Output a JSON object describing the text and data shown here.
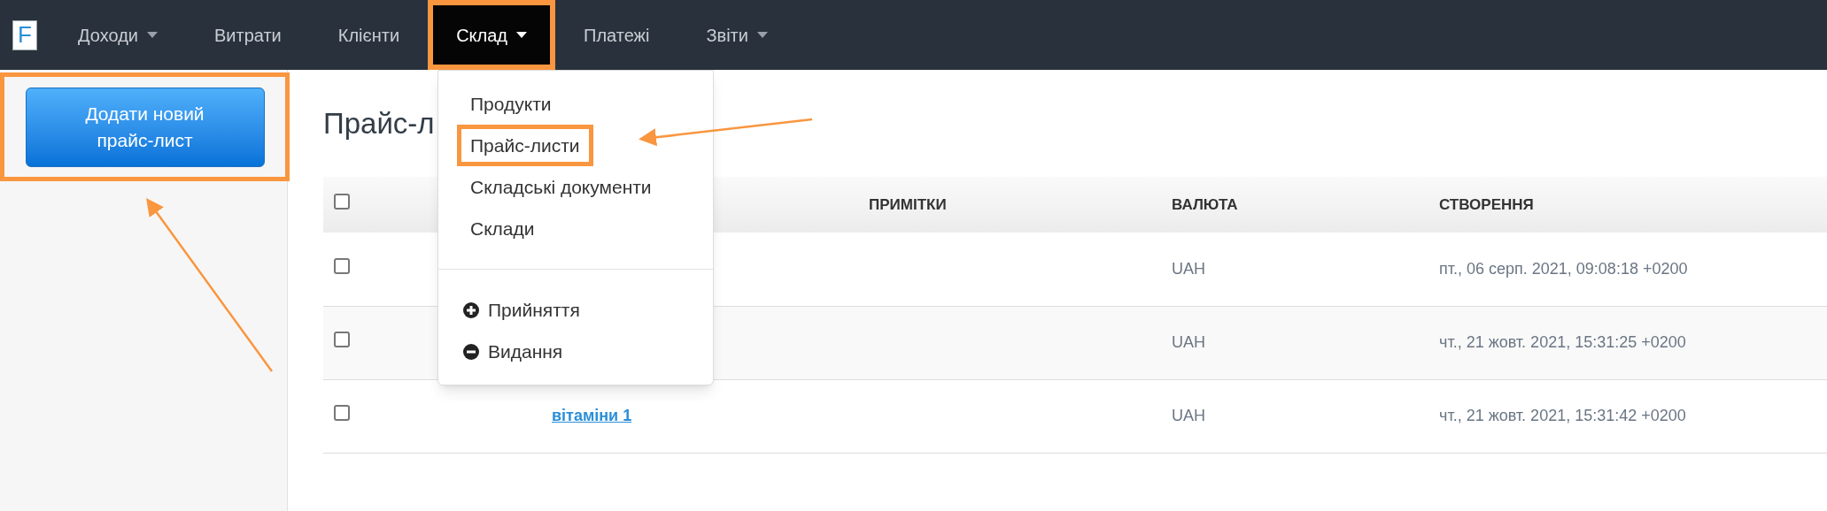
{
  "logo": {
    "letter": "F"
  },
  "nav": [
    {
      "label": "Доходи",
      "caret": true,
      "selected": false,
      "highlighted": false
    },
    {
      "label": "Витрати",
      "caret": false,
      "selected": false,
      "highlighted": false
    },
    {
      "label": "Клієнти",
      "caret": false,
      "selected": false,
      "highlighted": false
    },
    {
      "label": "Склад",
      "caret": true,
      "selected": true,
      "highlighted": true
    },
    {
      "label": "Платежі",
      "caret": false,
      "selected": false,
      "highlighted": false
    },
    {
      "label": "Звіти",
      "caret": true,
      "selected": false,
      "highlighted": false
    }
  ],
  "sidebar": {
    "button": {
      "label": "Додати новий прайс-лист",
      "highlighted": true
    }
  },
  "page_title": "Прайс-л",
  "table": {
    "select_all_checked": false,
    "columns": [
      "",
      "",
      "ПРИМІТКИ",
      "ВАЛЮТА",
      "СТВОРЕННЯ"
    ],
    "rows": [
      {
        "checked": false,
        "name": "",
        "currency": "UAH",
        "created": "пт., 06 серп. 2021, 09:08:18 +0200"
      },
      {
        "checked": false,
        "name": "",
        "currency": "UAH",
        "created": "чт., 21 жовт. 2021, 15:31:25 +0200"
      },
      {
        "checked": false,
        "name": "вітаміни 1",
        "currency": "UAH",
        "created": "чт., 21 жовт. 2021, 15:31:42 +0200"
      }
    ]
  },
  "dropdown": {
    "items": [
      {
        "kind": "link",
        "label": "Продукти",
        "highlighted": false
      },
      {
        "kind": "link",
        "label": "Прайс-листи",
        "highlighted": true
      },
      {
        "kind": "link",
        "label": "Складські документи",
        "highlighted": false
      },
      {
        "kind": "link",
        "label": "Склади",
        "highlighted": false
      },
      {
        "kind": "divider"
      },
      {
        "kind": "add",
        "label": "Прийняття",
        "highlighted": false
      },
      {
        "kind": "remove",
        "label": "Видання",
        "highlighted": false
      }
    ]
  }
}
